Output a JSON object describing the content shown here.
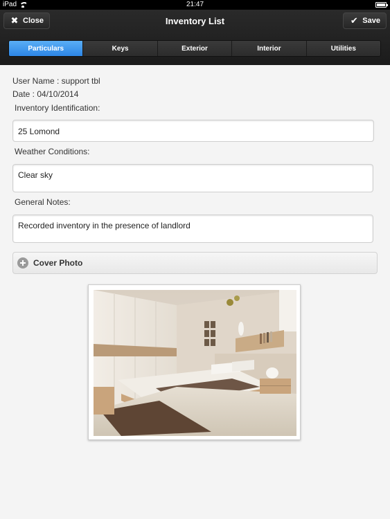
{
  "status_bar": {
    "device": "iPad",
    "time": "21:47"
  },
  "nav": {
    "title": "Inventory List",
    "close_label": "Close",
    "save_label": "Save"
  },
  "tabs": [
    {
      "label": "Particulars",
      "active": true
    },
    {
      "label": "Keys",
      "active": false
    },
    {
      "label": "Exterior",
      "active": false
    },
    {
      "label": "Interior",
      "active": false
    },
    {
      "label": "Utilities",
      "active": false
    }
  ],
  "form": {
    "user_name_line": "User Name  :  support tbl",
    "date_line": "Date  :  04/10/2014",
    "inventory_id_label": "Inventory Identification:",
    "inventory_id_value": "25 Lomond",
    "weather_label": "Weather Conditions:",
    "weather_value": "Clear sky",
    "notes_label": "General Notes:",
    "notes_value": "Recorded inventory in the presence of landlord"
  },
  "cover_photo": {
    "label": "Cover Photo"
  },
  "colors": {
    "accent": "#2d86e6",
    "nav_bg": "#1f1f1f",
    "page_bg": "#f4f4f4"
  }
}
